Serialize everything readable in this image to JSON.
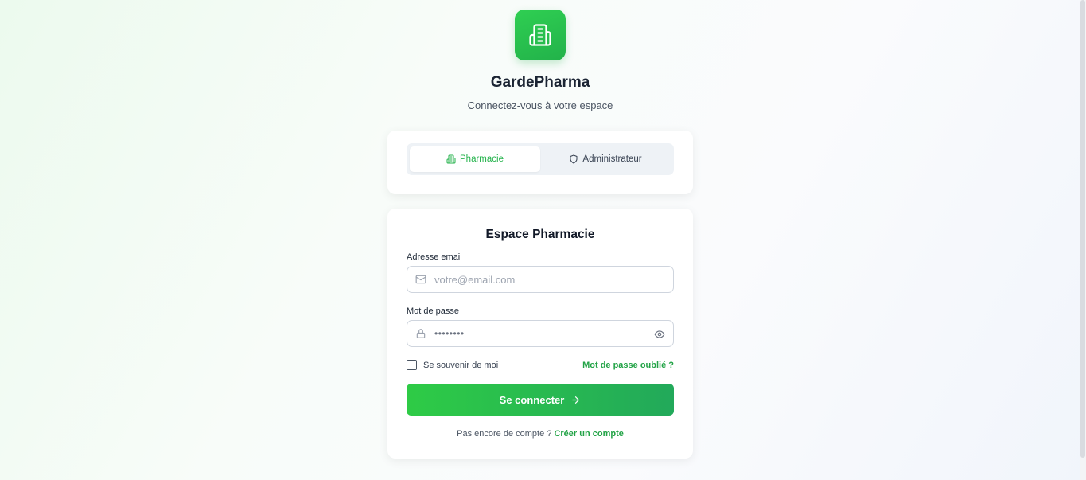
{
  "app": {
    "title": "GardePharma",
    "subtitle": "Connectez-vous à votre espace",
    "logo_icon": "pharmacy-building-icon",
    "accent_color": "#22b24a"
  },
  "tabs": [
    {
      "label": "Pharmacie",
      "icon": "building-icon",
      "active": true
    },
    {
      "label": "Administrateur",
      "icon": "shield-icon",
      "active": false
    }
  ],
  "form": {
    "title": "Espace Pharmacie",
    "email": {
      "label": "Adresse email",
      "placeholder": "votre@email.com",
      "icon": "mail-icon"
    },
    "password": {
      "label": "Mot de passe",
      "value": "••••••••",
      "icon": "lock-icon",
      "toggle_icon": "eye-icon"
    },
    "remember_label": "Se souvenir de moi",
    "forgot_label": "Mot de passe oublié ?",
    "submit_label": "Se connecter",
    "signup_prompt": "Pas encore de compte ?",
    "signup_link": "Créer un compte"
  }
}
